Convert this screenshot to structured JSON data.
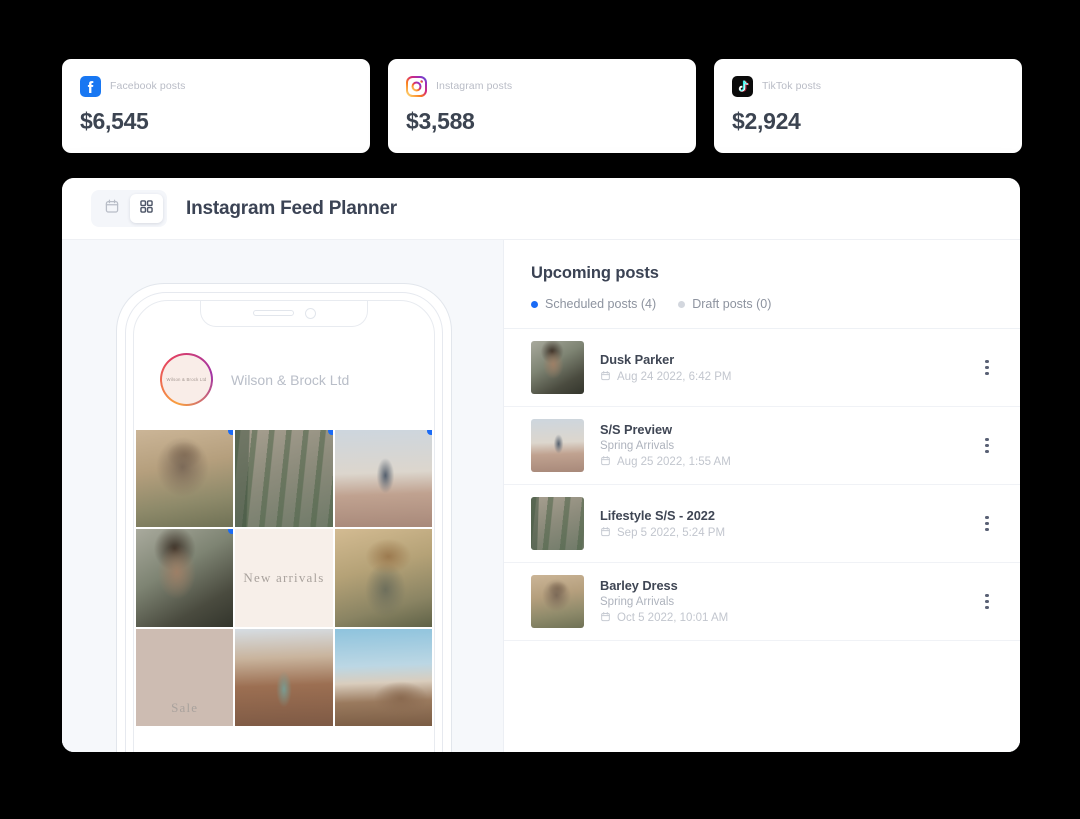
{
  "stat_cards": [
    {
      "icon": "facebook-icon",
      "label": "Facebook posts",
      "value": "$6,545",
      "color": "#1877F2"
    },
    {
      "icon": "instagram-icon",
      "label": "Instagram posts",
      "value": "$3,588",
      "color": "#E4405F"
    },
    {
      "icon": "tiktok-icon",
      "label": "TikTok posts",
      "value": "$2,924",
      "color": "#010101"
    }
  ],
  "app": {
    "title": "Instagram Feed Planner",
    "view_toggle": [
      {
        "name": "calendar-view",
        "icon": "calendar-icon",
        "active": false
      },
      {
        "name": "grid-view",
        "icon": "grid-icon",
        "active": true
      }
    ]
  },
  "phone": {
    "profile_name": "Wilson & Brock Ltd",
    "avatar_text": "Wilson & Brock Ltd",
    "grid": [
      {
        "art": "ph-hat-field",
        "label": "",
        "marker": true
      },
      {
        "art": "ph-cactus",
        "label": "",
        "marker": true
      },
      {
        "art": "ph-desert-man",
        "label": "",
        "marker": true
      },
      {
        "art": "ph-portrait-man",
        "label": "",
        "marker": true
      },
      {
        "art": "ph-newarr",
        "label": "New arrivals",
        "marker": false
      },
      {
        "art": "ph-woman-hat",
        "label": "",
        "marker": false
      },
      {
        "art": "ph-sale",
        "label": "Sale",
        "marker": false
      },
      {
        "art": "ph-canyon-woman",
        "label": "",
        "marker": false
      },
      {
        "art": "ph-cliff",
        "label": "",
        "marker": false
      }
    ]
  },
  "posts_panel": {
    "title": "Upcoming posts",
    "legend": [
      {
        "label": "Scheduled posts (4)",
        "color": "#1a6bf5"
      },
      {
        "label": "Draft posts (0)",
        "color": "#d3d7de"
      }
    ],
    "items": [
      {
        "title": "Dusk Parker",
        "subtitle": "",
        "date": "Aug 24 2022, 6:42 PM",
        "art": "ph-portrait-man"
      },
      {
        "title": "S/S Preview",
        "subtitle": "Spring Arrivals",
        "date": "Aug 25 2022, 1:55 AM",
        "art": "ph-desert-man"
      },
      {
        "title": "Lifestyle S/S - 2022",
        "subtitle": "",
        "date": "Sep 5 2022, 5:24 PM",
        "art": "ph-cactus"
      },
      {
        "title": "Barley Dress",
        "subtitle": "Spring Arrivals",
        "date": "Oct 5 2022, 10:01 AM",
        "art": "ph-hat-field"
      }
    ],
    "row_menu_icon": "kebab-menu-icon"
  },
  "colors": {
    "accent_blue": "#1a6bf5",
    "panel_bg": "#f6f8fb",
    "page_bg": "#000000"
  }
}
